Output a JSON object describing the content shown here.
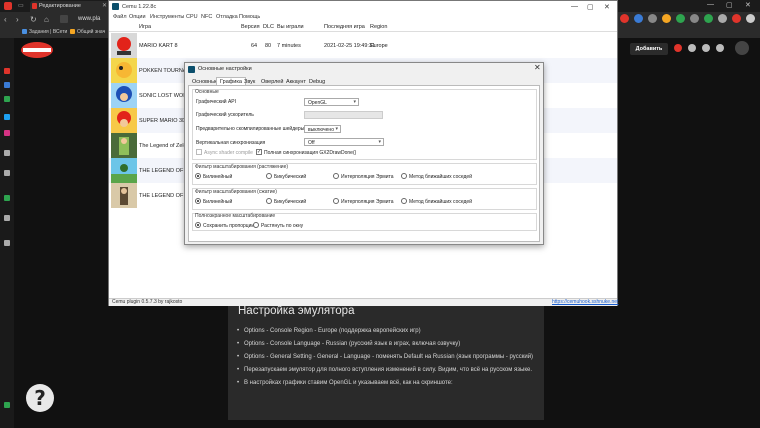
{
  "browser": {
    "tab_title": "Редактирование",
    "url": "www.pla",
    "bookmarks": [
      "Задания | ВСети",
      "Общий знач"
    ],
    "new_tab": "+"
  },
  "cemu": {
    "title": "Cemu 1.22.8c",
    "menu": [
      "Файл",
      "Опции",
      "Инструменты",
      "CPU",
      "NFC",
      "Отладка",
      "Помощь"
    ],
    "columns": [
      "Игра",
      "Версия",
      "DLC",
      "Вы играли",
      "Последняя игра",
      "Region"
    ],
    "games": [
      {
        "name": "MARIO KART 8",
        "version": "64",
        "dlc": "80",
        "played": "7 minutes",
        "last": "2021-02-25 19:49:31",
        "region": "Europe"
      },
      {
        "name": "POKKÉN TOURNAMENT",
        "version": "",
        "dlc": "",
        "played": "",
        "last": "",
        "region": ""
      },
      {
        "name": "SONIC LOST WORLD",
        "version": "",
        "dlc": "",
        "played": "",
        "last": "",
        "region": ""
      },
      {
        "name": "SUPER MARIO 3D WORLD",
        "version": "",
        "dlc": "",
        "played": "",
        "last": "",
        "region": ""
      },
      {
        "name": "The Legend of Zelda",
        "version": "",
        "dlc": "",
        "played": "",
        "last": "",
        "region": ""
      },
      {
        "name": "THE LEGEND OF ZELDA",
        "version": "",
        "dlc": "",
        "played": "",
        "last": "",
        "region": ""
      },
      {
        "name": "THE LEGEND OF ZELDA",
        "version": "",
        "dlc": "",
        "played": "",
        "last": "",
        "region": ""
      }
    ],
    "status_left": "Cemu plugin 0.5.7.3 by rajkosto",
    "status_link": "https://cemuhook.sshnuke.net"
  },
  "dialog": {
    "title": "Основные настройки",
    "tabs": [
      "Основные",
      "Графика",
      "Звук",
      "Оверлей",
      "Аккаунт",
      "Debug"
    ],
    "active_tab": "Графика",
    "group_main": "Основные",
    "api_label": "Графический API",
    "api_value": "OpenGL",
    "accel_label": "Графический ускоритель",
    "precompiled_label": "Предварительно скомпилированные шейдеры",
    "precompiled_value": "выключено",
    "vsync_label": "Вертикальная синхронизация",
    "vsync_value": "Off",
    "async_label": "Async shader compile",
    "fullsync_label": "Полная синхронизация GX2DrawDone()",
    "upscale_label": "Фильтр масштабирования (растяжение)",
    "downscale_label": "Фильтр масштабирования (сжатие)",
    "filters": [
      "Билинейный",
      "Бикубический",
      "Интерполяция Эрмита",
      "Метод ближайших соседей"
    ],
    "fullscreen_label": "Полноэкранное масштабирование",
    "fullscreen_options": [
      "Сохранить пропорции",
      "Растянуть по окну"
    ]
  },
  "site": {
    "add_button": "Добавить",
    "heading": "Настройка эмулятора",
    "items": [
      "Options - Console Region - Europe (поддержка европейских игр)",
      "Options - Console Language - Russian (русский язык в играх, включая озвучку)",
      "Options - General Setting - General - Language - поменять Default на Russian (язык программы - русский)",
      "Перезапускаем эмулятор для полного вступления изменений в силу. Видим, что всё на русском языке.",
      "В настройках графики ставим OpenGL и указываем всё, как на скриншоте:"
    ],
    "help": "?"
  }
}
